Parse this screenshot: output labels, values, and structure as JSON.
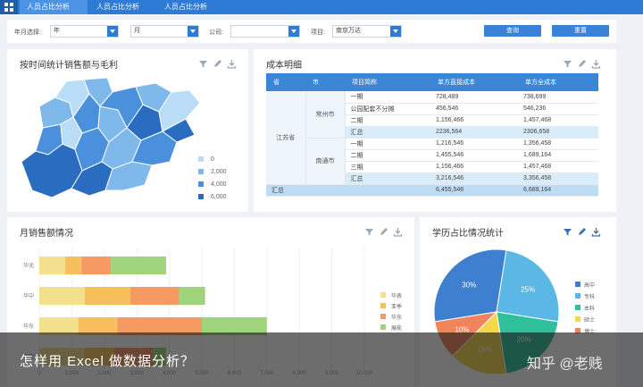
{
  "tabs": [
    "人员占比分析",
    "人员占比分析",
    "人员占比分析"
  ],
  "filters": {
    "year_label": "年月选择:",
    "year_value": "年",
    "month_value": "月",
    "company_label": "公司:",
    "company_value": "",
    "project_label": "项目:",
    "project_value": "南京万达",
    "query_label": "查询",
    "reset_label": "重置"
  },
  "map_panel": {
    "title": "按时间统计销售额与毛利",
    "legend": [
      "0",
      "2,000",
      "4,000",
      "6,000"
    ],
    "legend_colors": [
      "#b9dcf7",
      "#7fb9ec",
      "#4a90dc",
      "#2a6cc0"
    ]
  },
  "cost_panel": {
    "title": "成本明细",
    "headers": [
      "省",
      "市",
      "项目简称",
      "单方直接成本",
      "单方全成本"
    ],
    "province": "江苏省",
    "groups": [
      {
        "city": "常州市",
        "rows": [
          {
            "name": "一期",
            "direct": "728,489",
            "full": "738,699"
          },
          {
            "name": "公园配套不分摊",
            "direct": "456,546",
            "full": "546,236"
          },
          {
            "name": "二期",
            "direct": "1,156,466",
            "full": "1,457,468"
          }
        ],
        "sum": {
          "name": "汇总",
          "direct": "2236,564",
          "full": "2306,658"
        }
      },
      {
        "city": "南通市",
        "rows": [
          {
            "name": "一期",
            "direct": "1,216,546",
            "full": "1,356,458"
          },
          {
            "name": "二期",
            "direct": "1,455,546",
            "full": "1,689,164"
          },
          {
            "name": "三期",
            "direct": "1,156,466",
            "full": "1,457,468"
          }
        ],
        "sum": {
          "name": "汇总",
          "direct": "3,216,546",
          "full": "3,356,458"
        }
      }
    ],
    "total": {
      "name": "汇总",
      "direct": "6,455,546",
      "full": "6,689,164"
    }
  },
  "bar_panel": {
    "title": "月销售额情况",
    "legend_colors": [
      "#f3e08f",
      "#f6bf5c",
      "#f59a62",
      "#9fd47d"
    ]
  },
  "pie_panel": {
    "title": "学历占比情况统计"
  },
  "chart_data": [
    {
      "type": "bar",
      "orientation": "horizontal",
      "stacked": true,
      "categories": [
        "华北",
        "华中",
        "华东",
        "华南"
      ],
      "series": [
        {
          "name": "华表",
          "values": [
            800,
            1400,
            1200,
            1400
          ]
        },
        {
          "name": "亚季",
          "values": [
            500,
            1400,
            1200,
            900
          ]
        },
        {
          "name": "华东",
          "values": [
            900,
            1500,
            2600,
            1200
          ]
        },
        {
          "name": "展能",
          "values": [
            1700,
            800,
            2000,
            400
          ]
        }
      ],
      "xticks": [
        "0",
        "1,000",
        "2,000",
        "3,000",
        "4,000",
        "5,000",
        "6,000",
        "7,000",
        "8,000",
        "9,000",
        "10,000"
      ],
      "xlim": [
        0,
        10000
      ]
    },
    {
      "type": "pie",
      "labels": [
        "高中",
        "专科",
        "本科",
        "硕士",
        "博士"
      ],
      "values": [
        30,
        25,
        20,
        15,
        10
      ],
      "value_labels": [
        "30%",
        "25%",
        "20%",
        "15%",
        "10%"
      ],
      "colors": [
        "#3f7fcf",
        "#5bb8e6",
        "#2fbf9a",
        "#f5d84a",
        "#f2845c"
      ]
    }
  ],
  "banner": {
    "text": "怎样用 Excel 做数据分析？",
    "watermark": "知乎 @老贱"
  }
}
